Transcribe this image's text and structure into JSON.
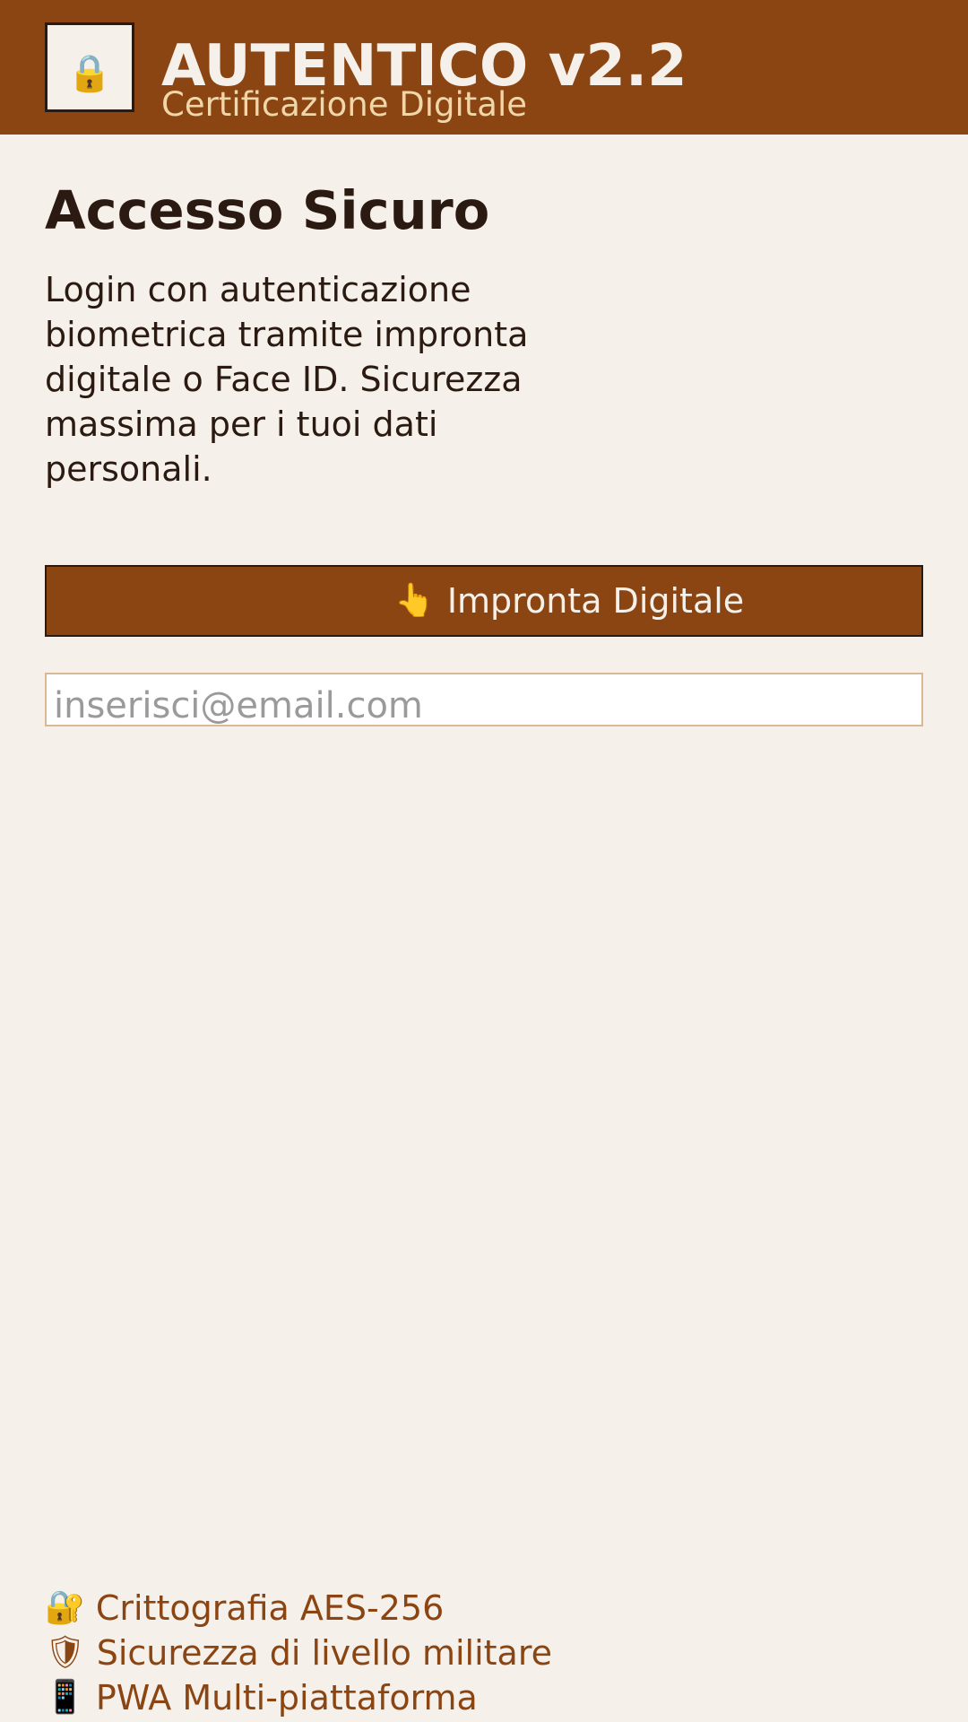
{
  "header": {
    "logo_icon": "lock-icon",
    "logo_glyph": "🔒",
    "title": "AUTENTICO v2.2",
    "subtitle": "Certificazione Digitale"
  },
  "main": {
    "title": "Accesso Sicuro",
    "description": "Login con autenticazione biometrica tramite impronta digitale o Face ID. Sicurezza massima per i tuoi dati personali.",
    "fingerprint_button": {
      "icon": "fingerprint-icon",
      "icon_glyph": "👆",
      "label": "Impronta Digitale"
    },
    "email_input": {
      "value": "",
      "placeholder": "inserisci@email.com"
    }
  },
  "features": [
    {
      "icon": "lock-icon",
      "icon_glyph": "🔐",
      "label": "Crittografia AES-256"
    },
    {
      "icon": "shield-icon",
      "icon_glyph": "🛡",
      "label": "Sicurezza di livello militare"
    },
    {
      "icon": "mobile-icon",
      "icon_glyph": "📱",
      "label": "PWA Multi-piattaforma"
    }
  ],
  "colors": {
    "brand": "#8b4513",
    "background": "#f5f0e9",
    "text_dark": "#2b1a12",
    "subtitle_accent": "#f0d6a8",
    "input_border": "#d9b994"
  }
}
